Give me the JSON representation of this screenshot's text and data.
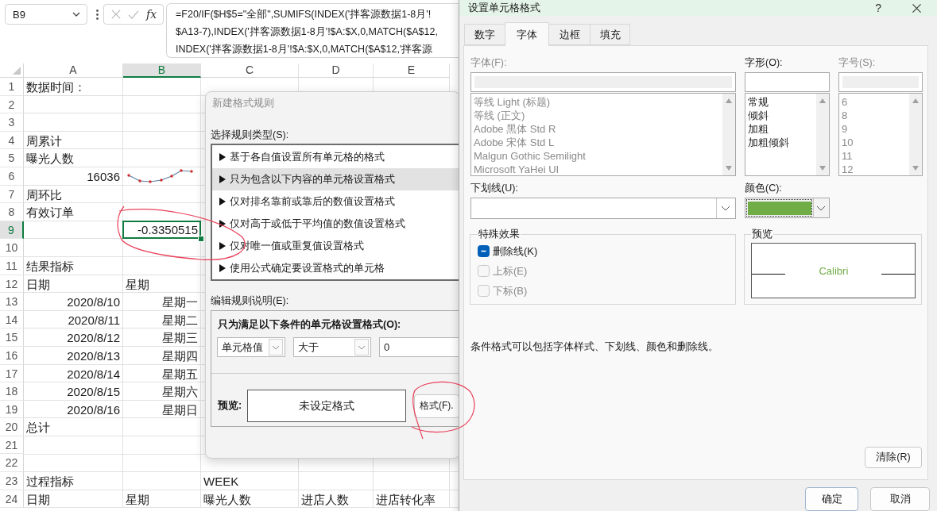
{
  "formula_bar": {
    "name_box": "B9",
    "function_button": "fx",
    "formula_lines": [
      "=F20/IF($H$5=\"全部\",SUMIFS(INDEX('拌客源数据1-8月'!",
      "$A13-7),INDEX('拌客源数据1-8月'!$A:$X,0,MATCH($A$12,",
      "INDEX('拌客源数据1-8月'!$A:$X,0,MATCH($A$12,'拌客源"
    ]
  },
  "sheet": {
    "columns": [
      {
        "label": "A",
        "selected": false
      },
      {
        "label": "B",
        "selected": true
      },
      {
        "label": "C",
        "selected": false
      },
      {
        "label": "D",
        "selected": false
      },
      {
        "label": "E",
        "selected": false
      }
    ],
    "rows": [
      {
        "number": "1",
        "selected": false,
        "a": {
          "kind": "text",
          "text": "数据时间：",
          "selected": false
        }
      },
      {
        "number": "2",
        "selected": false
      },
      {
        "number": "3",
        "selected": false
      },
      {
        "number": "4",
        "selected": false,
        "a": {
          "kind": "text",
          "text": "周累计",
          "selected": false
        }
      },
      {
        "number": "5",
        "selected": false,
        "a": {
          "kind": "text",
          "text": "曝光人数",
          "selected": false
        }
      },
      {
        "number": "6",
        "selected": false,
        "a": {
          "kind": "number",
          "text": "16036",
          "selected": false
        },
        "b": {
          "kind": "sparkline",
          "selected": false
        }
      },
      {
        "number": "7",
        "selected": false,
        "a": {
          "kind": "text",
          "text": "周环比",
          "selected": false
        }
      },
      {
        "number": "8",
        "selected": false,
        "a": {
          "kind": "text",
          "text": "有效订单",
          "selected": false
        }
      },
      {
        "number": "9",
        "selected": true,
        "b": {
          "kind": "number",
          "text": "-0.3350515",
          "selected": true
        }
      },
      {
        "number": "10",
        "selected": false
      },
      {
        "number": "11",
        "selected": false,
        "a": {
          "kind": "text",
          "text": "结果指标",
          "selected": false
        }
      },
      {
        "number": "12",
        "selected": false,
        "a": {
          "kind": "text",
          "text": "日期",
          "selected": false
        },
        "b": {
          "kind": "text",
          "text": "星期",
          "selected": false
        }
      },
      {
        "number": "13",
        "selected": false,
        "a": {
          "kind": "date",
          "text": "2020/8/10",
          "selected": false
        },
        "b": {
          "kind": "date",
          "text": "星期一",
          "selected": false
        }
      },
      {
        "number": "14",
        "selected": false,
        "a": {
          "kind": "date",
          "text": "2020/8/11",
          "selected": false
        },
        "b": {
          "kind": "date",
          "text": "星期二",
          "selected": false
        }
      },
      {
        "number": "15",
        "selected": false,
        "a": {
          "kind": "date",
          "text": "2020/8/12",
          "selected": false
        },
        "b": {
          "kind": "date",
          "text": "星期三",
          "selected": false
        }
      },
      {
        "number": "16",
        "selected": false,
        "a": {
          "kind": "date",
          "text": "2020/8/13",
          "selected": false
        },
        "b": {
          "kind": "date",
          "text": "星期四",
          "selected": false
        }
      },
      {
        "number": "17",
        "selected": false,
        "a": {
          "kind": "date",
          "text": "2020/8/14",
          "selected": false
        },
        "b": {
          "kind": "date",
          "text": "星期五",
          "selected": false
        }
      },
      {
        "number": "18",
        "selected": false,
        "a": {
          "kind": "date",
          "text": "2020/8/15",
          "selected": false
        },
        "b": {
          "kind": "date",
          "text": "星期六",
          "selected": false
        }
      },
      {
        "number": "19",
        "selected": false,
        "a": {
          "kind": "date",
          "text": "2020/8/16",
          "selected": false
        },
        "b": {
          "kind": "date",
          "text": "星期日",
          "selected": false
        }
      },
      {
        "number": "20",
        "selected": false,
        "a": {
          "kind": "text",
          "text": "总计",
          "selected": false
        }
      },
      {
        "number": "21",
        "selected": false
      },
      {
        "number": "22",
        "selected": false
      },
      {
        "number": "23",
        "selected": false,
        "a": {
          "kind": "text",
          "text": "过程指标",
          "selected": false
        },
        "c": {
          "kind": "text",
          "text": "WEEK",
          "selected": false
        }
      },
      {
        "number": "24",
        "selected": false,
        "a": {
          "kind": "text",
          "text": "日期",
          "selected": false
        },
        "b": {
          "kind": "text",
          "text": "星期",
          "selected": false
        },
        "c": {
          "kind": "text",
          "text": "曝光人数",
          "selected": false
        },
        "d": {
          "kind": "text",
          "text": "进店人数",
          "selected": false
        },
        "e": {
          "kind": "text",
          "text": "进店转化率",
          "selected": false
        }
      }
    ]
  },
  "rule_dialog": {
    "title": "新建格式规则",
    "rule_type_label": "选择规则类型(S):",
    "rule_types": [
      {
        "label": "基于各自值设置所有单元格的格式",
        "selected": false
      },
      {
        "label": "只为包含以下内容的单元格设置格式",
        "selected": true
      },
      {
        "label": "仅对排名靠前或靠后的数值设置格式",
        "selected": false
      },
      {
        "label": "仅对高于或低于平均值的数值设置格式",
        "selected": false
      },
      {
        "label": "仅对唯一值或重复值设置格式",
        "selected": false
      },
      {
        "label": "使用公式确定要设置格式的单元格",
        "selected": false
      }
    ],
    "description_label": "编辑规则说明(E):",
    "condition_label": "只为满足以下条件的单元格设置格式(O):",
    "condition": {
      "field": "单元格值",
      "operator": "大于",
      "value": "0"
    },
    "preview_label": "预览:",
    "preview_text": "未设定格式",
    "format_button": "格式(F)."
  },
  "format_dialog": {
    "title": "设置单元格格式",
    "help": "?",
    "tabs": [
      {
        "label": "数字",
        "selected": false
      },
      {
        "label": "字体",
        "selected": true
      },
      {
        "label": "边框",
        "selected": false
      },
      {
        "label": "填充",
        "selected": false
      }
    ],
    "font_list": {
      "label": "字体(F):",
      "disabled": true,
      "items": [
        {
          "label": "等线 Light (标题)",
          "selected": false
        },
        {
          "label": "等线 (正文)",
          "selected": false
        },
        {
          "label": "Adobe 黑体 Std R",
          "selected": false
        },
        {
          "label": "Adobe 宋体 Std L",
          "selected": false
        },
        {
          "label": "Malgun Gothic Semilight",
          "selected": false
        },
        {
          "label": "Microsoft YaHei UI",
          "selected": false
        }
      ]
    },
    "style_list": {
      "label": "字形(O):",
      "disabled": false,
      "items": [
        {
          "label": "常规",
          "selected": false
        },
        {
          "label": "倾斜",
          "selected": false
        },
        {
          "label": "加粗",
          "selected": false
        },
        {
          "label": "加粗倾斜",
          "selected": false
        }
      ]
    },
    "size_list": {
      "label": "字号(S):",
      "disabled": true,
      "items": [
        {
          "label": "6",
          "selected": false
        },
        {
          "label": "8",
          "selected": false
        },
        {
          "label": "9",
          "selected": false
        },
        {
          "label": "10",
          "selected": false
        },
        {
          "label": "11",
          "selected": false
        },
        {
          "label": "12",
          "selected": false
        }
      ]
    },
    "underline": {
      "label": "下划线(U):"
    },
    "font_color": {
      "label": "颜色(C):",
      "color": "#70ad47"
    },
    "effects": {
      "title": "特殊效果",
      "options": [
        {
          "label": "删除线(K)",
          "checked": false,
          "indeterminate": true,
          "disabled": false
        },
        {
          "label": "上标(E)",
          "checked": false,
          "indeterminate": false,
          "disabled": true
        },
        {
          "label": "下标(B)",
          "checked": false,
          "indeterminate": false,
          "disabled": true
        }
      ]
    },
    "preview": {
      "title": "预览",
      "sample": "Calibri"
    },
    "note": "条件格式可以包括字体样式、下划线、颜色和删除线。",
    "clear_button": "清除(R)",
    "buttons": [
      "确定",
      "取消"
    ]
  }
}
